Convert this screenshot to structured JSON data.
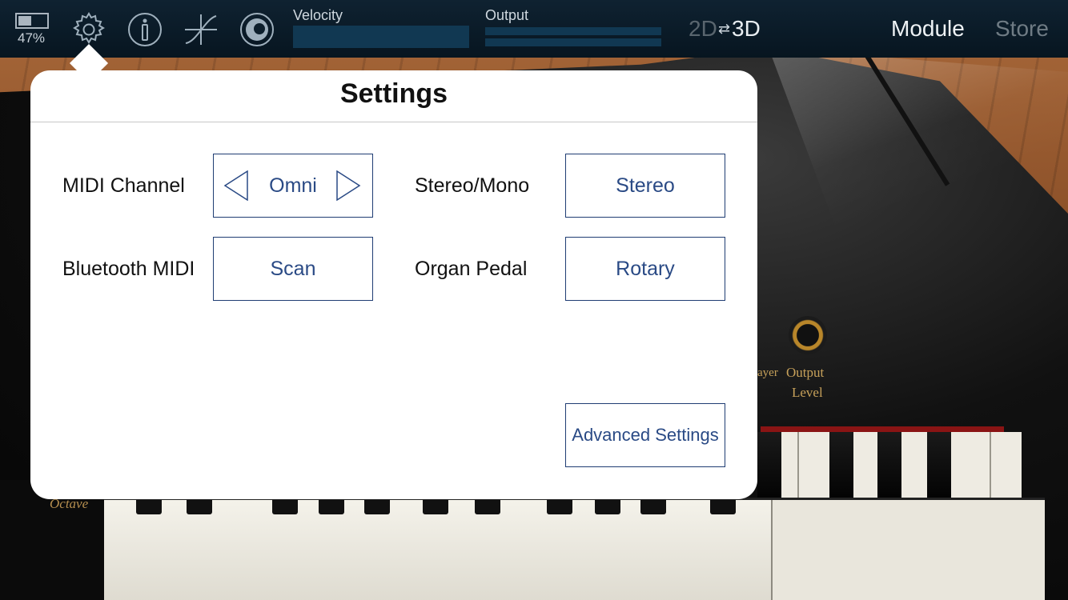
{
  "topbar": {
    "battery_text": "47%",
    "battery_level": 0.47,
    "velocity_label": "Velocity",
    "output_label": "Output",
    "view_2d": "2D",
    "view_swap": "⇄",
    "view_3d": "3D",
    "module_label": "Module",
    "store_label": "Store"
  },
  "settings": {
    "title": "Settings",
    "midi_channel_label": "MIDI Channel",
    "midi_channel_value": "Omni",
    "bluetooth_label": "Bluetooth MIDI",
    "bluetooth_button": "Scan",
    "stereo_label": "Stereo/Mono",
    "stereo_value": "Stereo",
    "pedal_label": "Organ Pedal",
    "pedal_value": "Rotary",
    "advanced_button": "Advanced Settings"
  },
  "piano": {
    "layer_label": "ayer",
    "output_level_label_1": "Output",
    "output_level_label_2": "Level",
    "octave_label": "Octave"
  },
  "colors": {
    "topbar_bg": "#0b1c29",
    "meter": "#113852",
    "button_text": "#2a4a85",
    "button_border": "#1f3d73"
  }
}
